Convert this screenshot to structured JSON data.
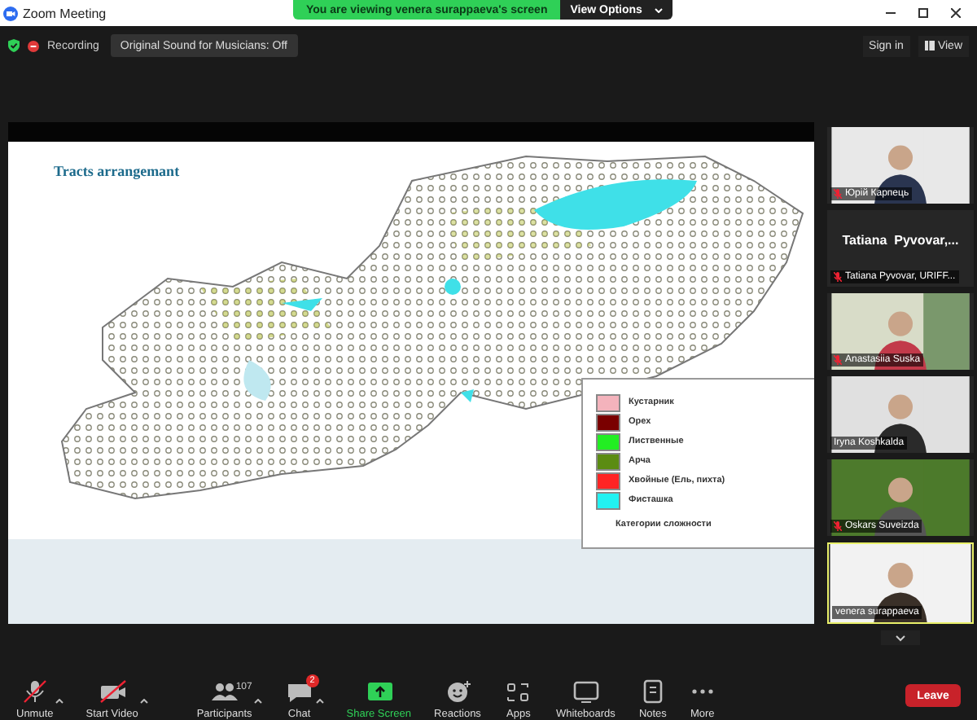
{
  "window": {
    "title": "Zoom Meeting"
  },
  "share_banner": {
    "text": "You are viewing venera surappaeva's screen",
    "button": "View Options"
  },
  "top_bar": {
    "recording": "Recording",
    "sound_button": "Original Sound for Musicians: Off",
    "sign_in": "Sign in",
    "view": "View"
  },
  "shared_screen": {
    "slide_title": "Tracts arrangemant",
    "legend": {
      "items": [
        {
          "label": "Кустарник",
          "color": "#f4b3bc"
        },
        {
          "label": "Орех",
          "color": "#7a0000"
        },
        {
          "label": "Лиственные",
          "color": "#22ee22"
        },
        {
          "label": "Арча",
          "color": "#5b8c12"
        },
        {
          "label": "Хвойные (Ель, пихта)",
          "color": "#ff2424"
        },
        {
          "label": "Фисташка",
          "color": "#22f2f2"
        }
      ],
      "caption": "Категории сложности"
    }
  },
  "gallery": [
    {
      "kind": "video",
      "name": "Юрій Карпець",
      "muted": true,
      "speaking": false
    },
    {
      "kind": "name_only",
      "display_name": "Tatiana  Pyvovar,...",
      "name": "Tatiana Pyvovar, URIFF...",
      "muted": true,
      "speaking": false
    },
    {
      "kind": "video",
      "name": "Anastasiia Suska",
      "muted": true,
      "speaking": false
    },
    {
      "kind": "video",
      "name": "Iryna Koshkalda",
      "muted": false,
      "speaking": false
    },
    {
      "kind": "video",
      "name": "Oskars Suveizda",
      "muted": true,
      "speaking": false
    },
    {
      "kind": "video",
      "name": "venera surappaeva",
      "muted": false,
      "speaking": true
    }
  ],
  "toolbar": [
    {
      "kind": "mic",
      "label": "Unmute",
      "caret": true
    },
    {
      "kind": "video",
      "label": "Start Video",
      "caret": true
    },
    {
      "kind": "participants",
      "label": "Participants",
      "count": "107",
      "caret": true
    },
    {
      "kind": "chat",
      "label": "Chat",
      "badge": "2",
      "caret": true
    },
    {
      "kind": "share",
      "label": "Share Screen",
      "caret": false
    },
    {
      "kind": "reactions",
      "label": "Reactions",
      "caret": false
    },
    {
      "kind": "apps",
      "label": "Apps",
      "caret": false
    },
    {
      "kind": "whiteboards",
      "label": "Whiteboards",
      "caret": false
    },
    {
      "kind": "notes",
      "label": "Notes",
      "caret": false
    },
    {
      "kind": "more",
      "label": "More",
      "caret": false
    }
  ],
  "leave_button": "Leave"
}
